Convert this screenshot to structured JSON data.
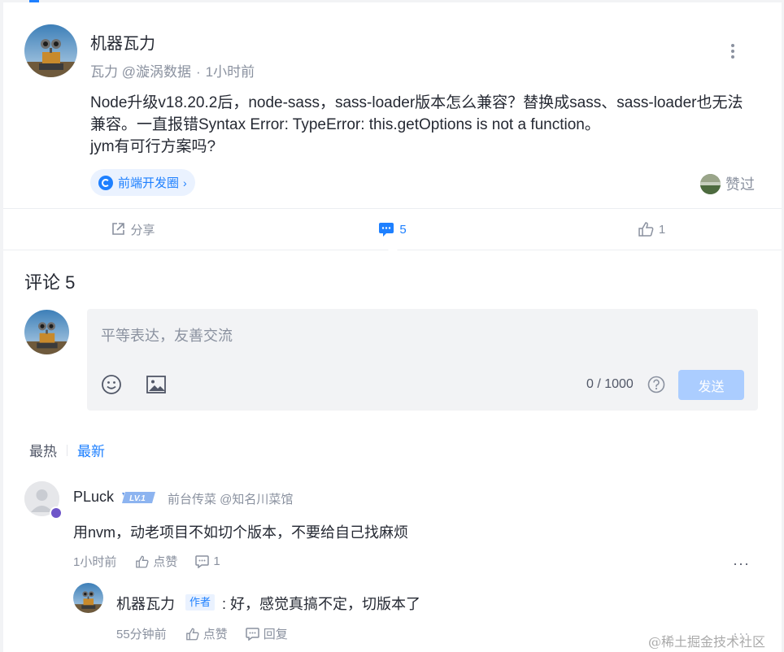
{
  "post": {
    "author_name": "机器瓦力",
    "author_title": "瓦力 @漩涡数据",
    "separator": "·",
    "time": "1小时前",
    "content_lines": [
      "Node升级v18.20.2后，node-sass，sass-loader版本怎么兼容？替换成sass、sass-loader也无法",
      "兼容。一直报错Syntax Error: TypeError: this.getOptions is not a function。",
      "jym有可行方案吗?"
    ],
    "circle_tag": "前端开发圈",
    "circle_chevron": "›",
    "liked_label": "赞过"
  },
  "actions": {
    "share_label": "分享",
    "comment_count": "5",
    "like_count": "1"
  },
  "comments_section": {
    "title": "评论 5",
    "editor": {
      "placeholder": "平等表达，友善交流",
      "counter": "0 / 1000",
      "send_label": "发送"
    },
    "sort": {
      "hot": "最热",
      "latest": "最新"
    }
  },
  "comments": [
    {
      "name": "PLuck",
      "level": "LV.1",
      "job": "前台传菜 @知名川菜馆",
      "text": "用nvm，动老项目不如切个版本，不要给自己找麻烦",
      "time": "1小时前",
      "like_label": "点赞",
      "reply_count": "1",
      "more": "···"
    }
  ],
  "replies": [
    {
      "name": "机器瓦力",
      "author_tag": "作者",
      "text": ": 好，感觉真搞不定，切版本了",
      "time": "55分钟前",
      "like_label": "点赞",
      "reply_label": "回复",
      "more": "···"
    }
  ],
  "watermark": "@稀土掘金技术社区",
  "colors": {
    "accent": "#1e80ff",
    "send_disabled": "#abcdff",
    "muted_text": "#8a919f"
  }
}
